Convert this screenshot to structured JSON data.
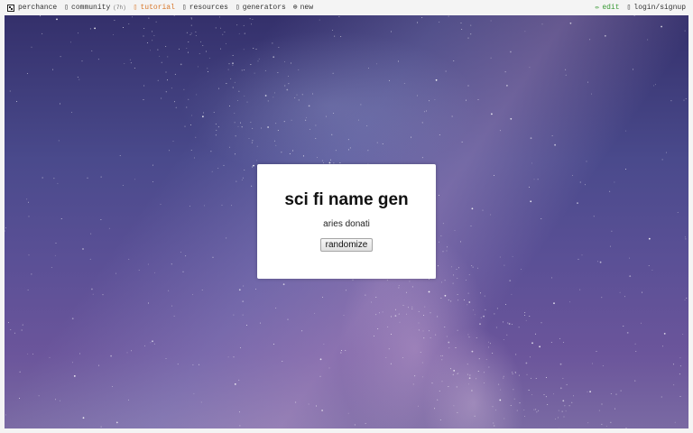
{
  "nav": {
    "left": [
      {
        "icon": "dice-icon",
        "label": "perchance"
      },
      {
        "icon": "chat-icon",
        "label": "community",
        "badge": "(7h)"
      },
      {
        "icon": "book-icon",
        "label": "tutorial"
      },
      {
        "icon": "link-icon",
        "label": "resources"
      },
      {
        "icon": "grid-icon",
        "label": "generators"
      },
      {
        "icon": "plus-circle-icon",
        "label": "new"
      }
    ],
    "right": [
      {
        "icon": "pencil-icon",
        "label": "edit"
      },
      {
        "icon": "user-icon",
        "label": "login/signup"
      }
    ]
  },
  "colors": {
    "tutorial": "#d8782c",
    "edit": "#3a9a36",
    "card_bg": "#ffffff"
  },
  "generator": {
    "title": "sci fi name gen",
    "output": "aries donati",
    "button_label": "randomize"
  }
}
